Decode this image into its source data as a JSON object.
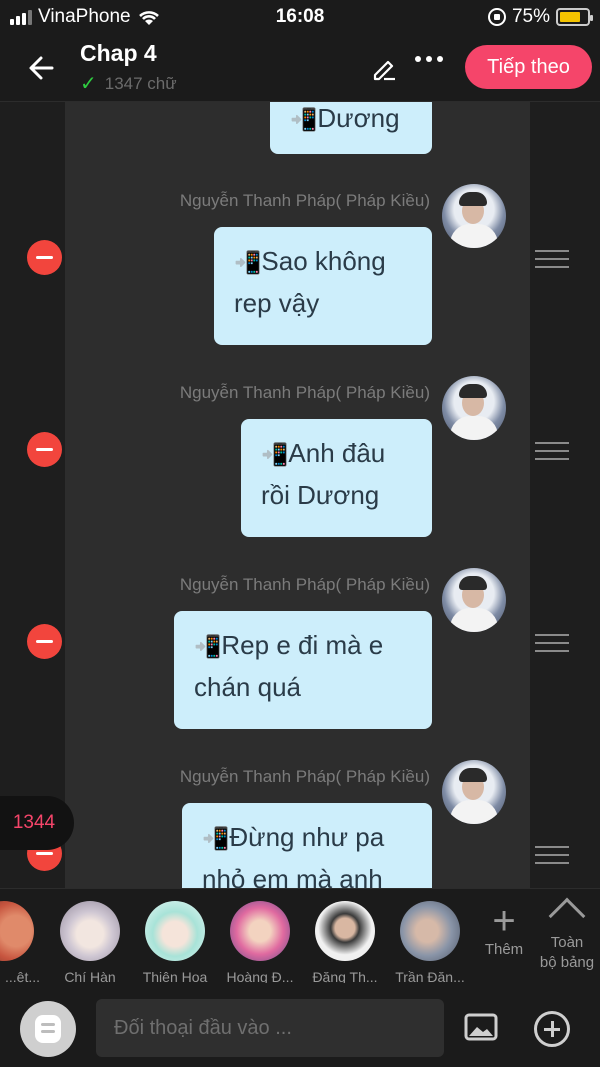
{
  "status_bar": {
    "carrier": "VinaPhone",
    "time": "16:08",
    "battery": "75%",
    "battery_level": 0.75
  },
  "header": {
    "title": "Chap 4",
    "word_count_label": "1347 chữ",
    "next_label": "Tiếp theo",
    "back_icon": "arrow-left-icon",
    "edit_icon": "pencil-icon",
    "more_icon": "more-horizontal-icon"
  },
  "chat": {
    "top_partial_text": "Dương",
    "messages": [
      {
        "sender": "Nguyễn Thanh Pháp( Pháp Kiều)",
        "lines": [
          "Sao không",
          "rep vậy"
        ]
      },
      {
        "sender": "Nguyễn Thanh Pháp( Pháp Kiều)",
        "lines": [
          "Anh đâu",
          "rồi Dương"
        ]
      },
      {
        "sender": "Nguyễn Thanh Pháp( Pháp Kiều)",
        "lines": [
          "Rep e đi mà e",
          "chán quá"
        ]
      },
      {
        "sender": "Nguyễn Thanh Pháp( Pháp Kiều)",
        "lines": [
          "Đừng như pa",
          "nhỏ em mà anh"
        ]
      }
    ],
    "phone_icon": "📲",
    "floating_count": "1344"
  },
  "characters": [
    {
      "name": "...ệt...",
      "color": "#c7553f"
    },
    {
      "name": "Chí Hàn",
      "color": "#d9d4dc"
    },
    {
      "name": "Thiên Hoa",
      "color": "#a8e3d8"
    },
    {
      "name": "Hoàng Đ...",
      "color": "#e06aa0"
    },
    {
      "name": "Đặng Th...",
      "color": "#e9e9e9"
    },
    {
      "name": "Trần Đăn...",
      "color": "#8a95a8"
    }
  ],
  "char_actions": {
    "add_label": "Thêm",
    "all_board_line1": "Toàn",
    "all_board_line2": "bộ bảng"
  },
  "input_bar": {
    "placeholder": "Đối thoại đầu vào ..."
  },
  "colors": {
    "accent": "#f5456a",
    "bubble": "#cdeefb",
    "remove": "#f2453d"
  }
}
